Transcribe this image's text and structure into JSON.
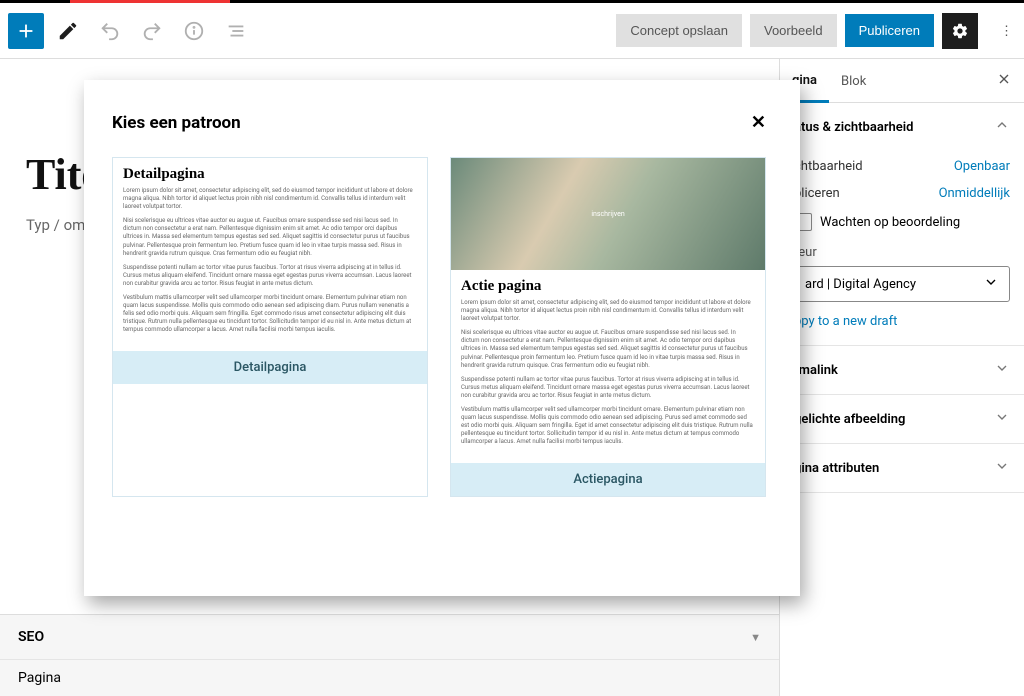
{
  "toolbar": {
    "draft_btn": "Concept opslaan",
    "preview_btn": "Voorbeeld",
    "publish_btn": "Publiceren"
  },
  "canvas": {
    "title_placeholder": "Titel",
    "body_placeholder": "Typ / om ee",
    "seo_heading": "SEO",
    "seo_tab": "Pagina"
  },
  "sidebar": {
    "tabs": {
      "page": "gina",
      "block": "Blok"
    },
    "panels": {
      "status": {
        "title": "atus & zichtbaarheid",
        "visibility_label": "chtbaarheid",
        "visibility_value": "Openbaar",
        "publish_label": "bliceren",
        "publish_value": "Onmiddellijk",
        "review_label": "Wachten op beoordeling",
        "author_label": "teur",
        "author_value": "ard | Digital Agency",
        "copy_draft": "ppy to a new draft"
      },
      "permalink": "rmalink",
      "featured": "gelichte afbeelding",
      "attributes": "gina attributen"
    }
  },
  "modal": {
    "title": "Kies een patroon",
    "card1": {
      "heading": "Detailpagina",
      "footer": "Detailpagina",
      "p1": "Lorem ipsum dolor sit amet, consectetur adipiscing elit, sed do eiusmod tempor incididunt ut labore et dolore magna aliqua. Nibh tortor id aliquet lectus proin nibh nisl condimentum id. Convallis tellus id interdum velit laoreet volutpat tortor.",
      "p2": "Nisi scelerisque eu ultrices vitae auctor eu augue ut. Faucibus ornare suspendisse sed nisi lacus sed. In dictum non consectetur a erat nam. Pellentesque dignissim enim sit amet. Ac odio tempor orci dapibus ultrices in. Massa sed elementum tempus egestas sed sed. Aliquet sagittis id consectetur purus ut faucibus pulvinar. Pellentesque proin fermentum leo. Pretium fusce quam id leo in vitae turpis massa sed. Risus in hendrerit gravida rutrum quisque. Cras fermentum odio eu feugiat nibh.",
      "p3": "Suspendisse potenti nullam ac tortor vitae purus faucibus. Tortor at risus viverra adipiscing at in tellus id. Cursus metus aliquam eleifend. Tincidunt ornare massa eget egestas purus viverra accumsan. Lacus laoreet non curabitur gravida arcu ac tortor. Risus feugiat in ante metus dictum.",
      "p4": "Vestibulum mattis ullamcorper velit sed ullamcorper morbi tincidunt ornare. Elementum pulvinar etiam non quam lacus suspendisse. Mollis quis commodo odio aenean sed adipiscing diam. Purus nullam venenatis a felis sed odio morbi quis. Aliquam sem fringilla. Eget commodo risus amet consectetur adipiscing elit duis tristique. Rutrum nulla pellentesque eu tincidunt tortor. Sollicitudin tempor id eu nisl in. Ante metus dictum at tempus commodo ullamcorper a lacus. Amet nulla facilisi morbi tempus iaculis."
    },
    "card2": {
      "heading": "Actie pagina",
      "hero_text": "inschrijven",
      "footer": "Actiepagina",
      "p1": "Lorem ipsum dolor sit amet, consectetur adipiscing elit, sed do eiusmod tempor incididunt ut labore et dolore magna aliqua. Nibh tortor id aliquet lectus proin nibh nisl condimentum id. Convallis tellus id interdum velit laoreet volutpat tortor.",
      "p2": "Nisi scelerisque eu ultrices vitae auctor eu augue ut. Faucibus ornare suspendisse sed nisi lacus sed. In dictum non consectetur a erat nam. Pellentesque dignissim enim sit amet. Ac odio tempor orci dapibus ultrices in. Massa sed elementum tempus egestas sed sed. Aliquet sagittis id consectetur purus ut faucibus pulvinar. Pellentesque proin fermentum leo. Pretium fusce quam id leo in vitae turpis massa sed. Risus in hendrerit gravida rutrum quisque. Cras fermentum odio eu feugiat nibh.",
      "p3": "Suspendisse potenti nullam ac tortor vitae purus faucibus. Tortor at risus viverra adipiscing at in tellus id. Cursus metus aliquam eleifend. Tincidunt ornare massa eget egestas purus viverra accumsan. Lacus laoreet non curabitur gravida arcu ac tortor. Risus feugiat in ante metus dictum.",
      "p4": "Vestibulum mattis ullamcorper velit sed ullamcorper morbi tincidunt ornare. Elementum pulvinar etiam non quam lacus suspendisse. Mollis quis commodo odio aenean sed adipiscing. Purus sed amet commodo sed est odio morbi quis. Aliquam sem fringilla. Eget id amet consectetur adipiscing elit duis tristique. Rutrum nulla pellentesque eu tincidunt tortor. Sollicitudin tempor id eu nisl in. Ante metus dictum at tempus commodo ullamcorper a lacus. Amet nulla facilisi morbi tempus iaculis."
    }
  }
}
